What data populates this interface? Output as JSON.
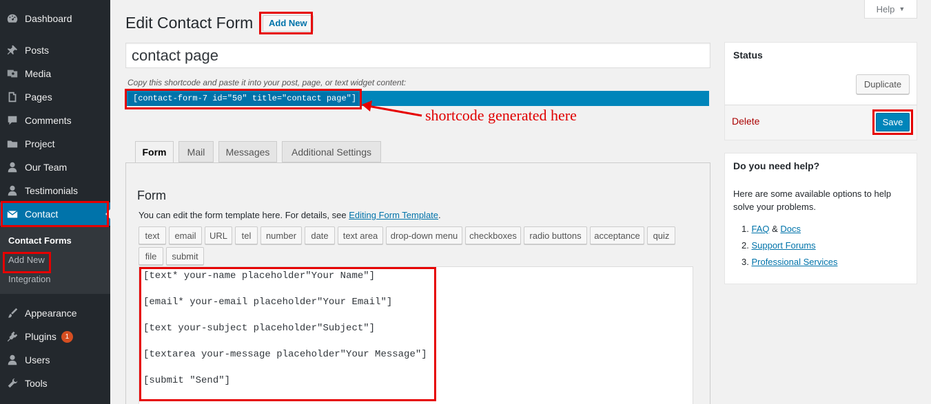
{
  "sidebar": {
    "items": [
      {
        "label": "Dashboard",
        "icon": "dashboard-icon"
      },
      {
        "label": "Posts",
        "icon": "pin-icon"
      },
      {
        "label": "Media",
        "icon": "media-icon"
      },
      {
        "label": "Pages",
        "icon": "pages-icon"
      },
      {
        "label": "Comments",
        "icon": "comment-icon"
      },
      {
        "label": "Project",
        "icon": "folder-icon"
      },
      {
        "label": "Our Team",
        "icon": "user-icon"
      },
      {
        "label": "Testimonials",
        "icon": "user-icon"
      },
      {
        "label": "Contact",
        "icon": "envelope-icon"
      },
      {
        "label": "Appearance",
        "icon": "brush-icon"
      },
      {
        "label": "Plugins",
        "icon": "plugin-icon",
        "badge": "1"
      },
      {
        "label": "Users",
        "icon": "user-icon"
      },
      {
        "label": "Tools",
        "icon": "wrench-icon"
      }
    ],
    "submenu": [
      "Contact Forms",
      "Add New",
      "Integration"
    ]
  },
  "header": {
    "title": "Edit Contact Form",
    "add_new": "Add New",
    "help": "Help"
  },
  "title_input": "contact page",
  "shortcode": {
    "description": "Copy this shortcode and paste it into your post, page, or text widget content:",
    "code": "[contact-form-7 id=\"50\" title=\"contact page\"]",
    "annotation": "shortcode generated here"
  },
  "tabs": [
    "Form",
    "Mail",
    "Messages",
    "Additional Settings"
  ],
  "form": {
    "heading": "Form",
    "desc_prefix": "You can edit the form template here. For details, see ",
    "desc_link": "Editing Form Template",
    "desc_suffix": ".",
    "tags": [
      "text",
      "email",
      "URL",
      "tel",
      "number",
      "date",
      "text area",
      "drop-down menu",
      "checkboxes",
      "radio buttons",
      "acceptance",
      "quiz",
      "file",
      "submit"
    ],
    "code_lines": [
      "[text* your-name placeholder\"Your Name\"]",
      "[email* your-email placeholder\"Your Email\"]",
      "[text your-subject placeholder\"Subject\"]",
      "[textarea your-message placeholder\"Your Message\"]",
      "[submit \"Send\"]"
    ]
  },
  "status": {
    "title": "Status",
    "duplicate": "Duplicate",
    "delete": "Delete",
    "save": "Save"
  },
  "help_box": {
    "title": "Do you need help?",
    "text": "Here are some available options to help solve your problems.",
    "item1_num": "1.",
    "item1_a": "FAQ",
    "item1_amp": "&",
    "item1_b": "Docs",
    "item2_num": "2.",
    "item2": "Support Forums",
    "item3_num": "3.",
    "item3": "Professional Services"
  },
  "colors": {
    "sidebar_bg": "#23282d",
    "accent": "#0073aa",
    "highlight": "#e60000"
  }
}
